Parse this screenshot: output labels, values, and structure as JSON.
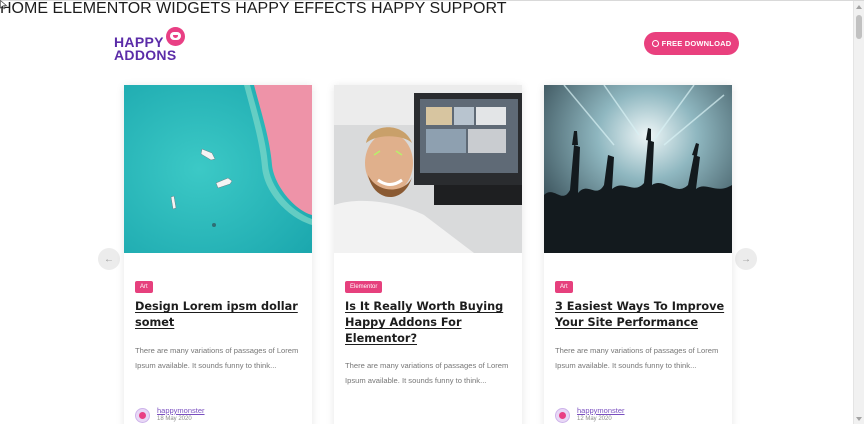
{
  "brand": {
    "line1": "HAPPY",
    "line2": "ADDONS",
    "accent": "#e9407e",
    "purple": "#5b2ca8"
  },
  "nav": {
    "items": [
      "HOME",
      "ELEMENTOR WIDGETS",
      "HAPPY EFFECTS",
      "HAPPY SUPPORT"
    ]
  },
  "cta": {
    "label": "FREE DOWNLOAD",
    "icon": "wordpress-icon"
  },
  "carousel": {
    "prev_icon": "arrow-left-icon",
    "next_icon": "arrow-right-icon",
    "posts": [
      {
        "category": "Art",
        "title": "Design Lorem ipsm dollar somet",
        "excerpt": "There are many variations of passages of Lorem Ipsum available. It sounds funny to think...",
        "author": "happymonster",
        "date": "18 May 2020",
        "image": "aerial-beach-boats"
      },
      {
        "category": "Elementor",
        "title": "Is It Really Worth Buying Happy Addons For Elementor?",
        "excerpt": "There are many variations of passages of Lorem Ipsum available. It sounds funny to think...",
        "author": "",
        "date": "",
        "image": "smiling-man-at-computer"
      },
      {
        "category": "Art",
        "title": "3 Easiest Ways To Improve Your Site Performance",
        "excerpt": "There are many variations of passages of Lorem Ipsum available. It sounds funny to think...",
        "author": "happymonster",
        "date": "12 May 2020",
        "image": "concert-crowd"
      }
    ]
  }
}
